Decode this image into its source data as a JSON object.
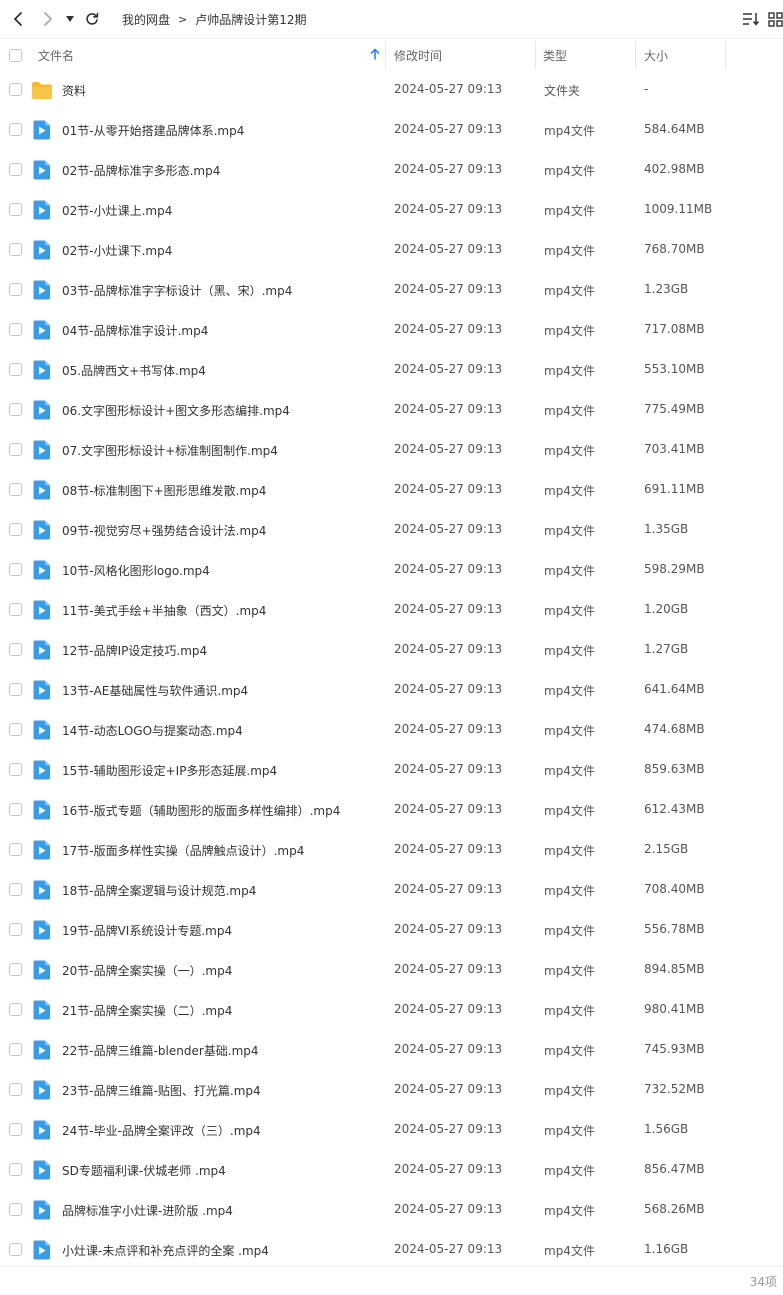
{
  "toolbar": {
    "breadcrumb": [
      "我的网盘",
      "卢帅品牌设计第12期"
    ],
    "separator": ">"
  },
  "header": {
    "name": "文件名",
    "modified": "修改时间",
    "type": "类型",
    "size": "大小"
  },
  "colors": {
    "folder": "#F5B82E",
    "video": "#3A9BE8",
    "sort_arrow": "#2F86F0"
  },
  "files": [
    {
      "name": "资料",
      "time": "2024-05-27 09:13",
      "type": "文件夹",
      "size": "-",
      "icon": "folder-icon"
    },
    {
      "name": "01节-从零开始搭建品牌体系.mp4",
      "time": "2024-05-27 09:13",
      "type": "mp4文件",
      "size": "584.64MB",
      "icon": "video-file-icon"
    },
    {
      "name": "02节-品牌标准字多形态.mp4",
      "time": "2024-05-27 09:13",
      "type": "mp4文件",
      "size": "402.98MB",
      "icon": "video-file-icon"
    },
    {
      "name": "02节-小灶课上.mp4",
      "time": "2024-05-27 09:13",
      "type": "mp4文件",
      "size": "1009.11MB",
      "icon": "video-file-icon"
    },
    {
      "name": "02节-小灶课下.mp4",
      "time": "2024-05-27 09:13",
      "type": "mp4文件",
      "size": "768.70MB",
      "icon": "video-file-icon"
    },
    {
      "name": "03节-品牌标准字字标设计（黑、宋）.mp4",
      "time": "2024-05-27 09:13",
      "type": "mp4文件",
      "size": "1.23GB",
      "icon": "video-file-icon"
    },
    {
      "name": "04节-品牌标准字设计.mp4",
      "time": "2024-05-27 09:13",
      "type": "mp4文件",
      "size": "717.08MB",
      "icon": "video-file-icon"
    },
    {
      "name": "05.品牌西文+书写体.mp4",
      "time": "2024-05-27 09:13",
      "type": "mp4文件",
      "size": "553.10MB",
      "icon": "video-file-icon"
    },
    {
      "name": "06.文字图形标设计+图文多形态编排.mp4",
      "time": "2024-05-27 09:13",
      "type": "mp4文件",
      "size": "775.49MB",
      "icon": "video-file-icon"
    },
    {
      "name": "07.文字图形标设计+标准制图制作.mp4",
      "time": "2024-05-27 09:13",
      "type": "mp4文件",
      "size": "703.41MB",
      "icon": "video-file-icon"
    },
    {
      "name": "08节-标准制图下+图形思维发散.mp4",
      "time": "2024-05-27 09:13",
      "type": "mp4文件",
      "size": "691.11MB",
      "icon": "video-file-icon"
    },
    {
      "name": "09节-视觉穷尽+强势结合设计法.mp4",
      "time": "2024-05-27 09:13",
      "type": "mp4文件",
      "size": "1.35GB",
      "icon": "video-file-icon"
    },
    {
      "name": "10节-风格化图形logo.mp4",
      "time": "2024-05-27 09:13",
      "type": "mp4文件",
      "size": "598.29MB",
      "icon": "video-file-icon"
    },
    {
      "name": "11节-美式手绘+半抽象（西文）.mp4",
      "time": "2024-05-27 09:13",
      "type": "mp4文件",
      "size": "1.20GB",
      "icon": "video-file-icon"
    },
    {
      "name": "12节-品牌IP设定技巧.mp4",
      "time": "2024-05-27 09:13",
      "type": "mp4文件",
      "size": "1.27GB",
      "icon": "video-file-icon"
    },
    {
      "name": "13节-AE基础属性与软件通识.mp4",
      "time": "2024-05-27 09:13",
      "type": "mp4文件",
      "size": "641.64MB",
      "icon": "video-file-icon"
    },
    {
      "name": "14节-动态LOGO与提案动态.mp4",
      "time": "2024-05-27 09:13",
      "type": "mp4文件",
      "size": "474.68MB",
      "icon": "video-file-icon"
    },
    {
      "name": "15节-辅助图形设定+IP多形态延展.mp4",
      "time": "2024-05-27 09:13",
      "type": "mp4文件",
      "size": "859.63MB",
      "icon": "video-file-icon"
    },
    {
      "name": "16节-版式专题（辅助图形的版面多样性编排）.mp4",
      "time": "2024-05-27 09:13",
      "type": "mp4文件",
      "size": "612.43MB",
      "icon": "video-file-icon"
    },
    {
      "name": "17节-版面多样性实操（品牌触点设计）.mp4",
      "time": "2024-05-27 09:13",
      "type": "mp4文件",
      "size": "2.15GB",
      "icon": "video-file-icon"
    },
    {
      "name": "18节-品牌全案逻辑与设计规范.mp4",
      "time": "2024-05-27 09:13",
      "type": "mp4文件",
      "size": "708.40MB",
      "icon": "video-file-icon"
    },
    {
      "name": "19节-品牌VI系统设计专题.mp4",
      "time": "2024-05-27 09:13",
      "type": "mp4文件",
      "size": "556.78MB",
      "icon": "video-file-icon"
    },
    {
      "name": "20节-品牌全案实操（一）.mp4",
      "time": "2024-05-27 09:13",
      "type": "mp4文件",
      "size": "894.85MB",
      "icon": "video-file-icon"
    },
    {
      "name": "21节-品牌全案实操（二）.mp4",
      "time": "2024-05-27 09:13",
      "type": "mp4文件",
      "size": "980.41MB",
      "icon": "video-file-icon"
    },
    {
      "name": "22节-品牌三维篇-blender基础.mp4",
      "time": "2024-05-27 09:13",
      "type": "mp4文件",
      "size": "745.93MB",
      "icon": "video-file-icon"
    },
    {
      "name": "23节-品牌三维篇-贴图、打光篇.mp4",
      "time": "2024-05-27 09:13",
      "type": "mp4文件",
      "size": "732.52MB",
      "icon": "video-file-icon"
    },
    {
      "name": "24节-毕业-品牌全案评改（三）.mp4",
      "time": "2024-05-27 09:13",
      "type": "mp4文件",
      "size": "1.56GB",
      "icon": "video-file-icon"
    },
    {
      "name": "SD专题福利课-伏城老师 .mp4",
      "time": "2024-05-27 09:13",
      "type": "mp4文件",
      "size": "856.47MB",
      "icon": "video-file-icon"
    },
    {
      "name": "品牌标准字小灶课-进阶版 .mp4",
      "time": "2024-05-27 09:13",
      "type": "mp4文件",
      "size": "568.26MB",
      "icon": "video-file-icon"
    },
    {
      "name": "小灶课-未点评和补充点评的全案 .mp4",
      "time": "2024-05-27 09:13",
      "type": "mp4文件",
      "size": "1.16GB",
      "icon": "video-file-icon"
    }
  ],
  "footer": {
    "count": "34项"
  }
}
